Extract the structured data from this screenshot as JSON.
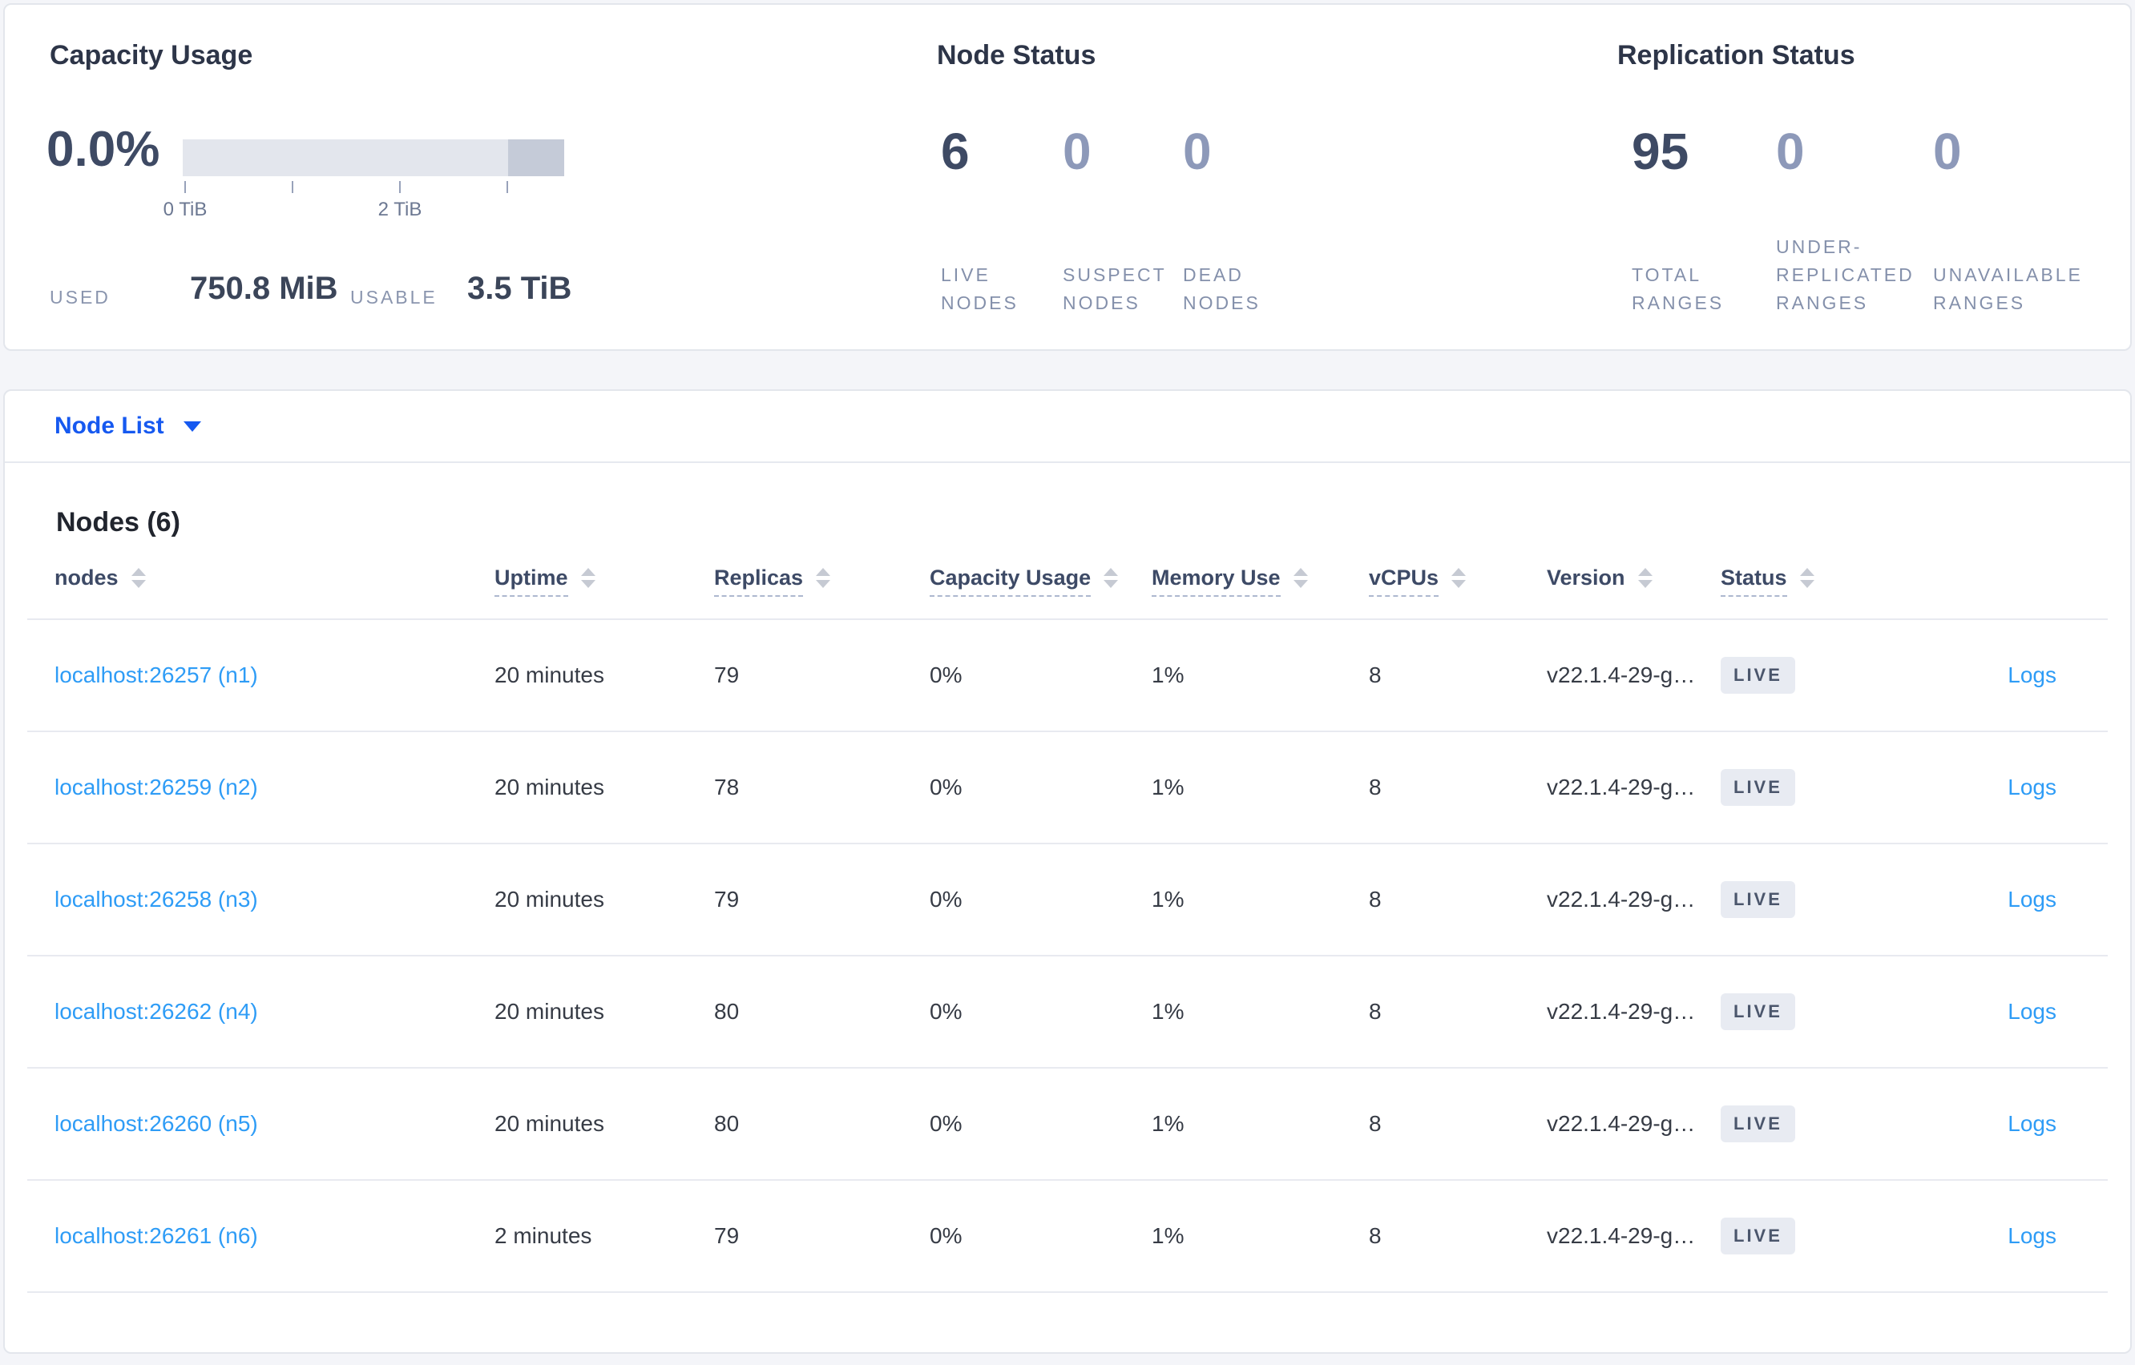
{
  "colors": {
    "accent_blue": "#1659f0",
    "link_blue": "#2e9cf6",
    "dark_number": "#3e4a64",
    "muted_number": "#8d99b9",
    "badge_bg": "#e8ebf2",
    "bar_light": "#e3e6ed",
    "bar_dark": "#c5cbd8"
  },
  "capacity": {
    "title": "Capacity Usage",
    "percent": "0.0%",
    "axis_label_0": "0 TiB",
    "axis_label_2": "2 TiB",
    "used_label": "USED",
    "used_value": "750.8 MiB",
    "usable_label": "USABLE",
    "usable_value": "3.5 TiB"
  },
  "node_status": {
    "title": "Node Status",
    "stats": [
      {
        "value": "6",
        "label": "LIVE\nNODES"
      },
      {
        "value": "0",
        "label": "SUSPECT\nNODES"
      },
      {
        "value": "0",
        "label": "DEAD\nNODES"
      }
    ]
  },
  "replication_status": {
    "title": "Replication Status",
    "stats": [
      {
        "value": "95",
        "label": "TOTAL\nRANGES"
      },
      {
        "value": "0",
        "label": "UNDER-\nREPLICATED\nRANGES"
      },
      {
        "value": "0",
        "label": "UNAVAILABLE\nRANGES"
      }
    ]
  },
  "node_list": {
    "selector_label": "Node List",
    "heading": "Nodes (6)"
  },
  "table": {
    "columns": [
      "nodes",
      "Uptime",
      "Replicas",
      "Capacity Usage",
      "Memory Use",
      "vCPUs",
      "Version",
      "Status"
    ],
    "rows": [
      {
        "node": "localhost:26257 (n1)",
        "uptime": "20 minutes",
        "replicas": "79",
        "capacity": "0%",
        "memory": "1%",
        "vcpus": "8",
        "version": "v22.1.4-29-g…",
        "status": "LIVE",
        "logs": "Logs"
      },
      {
        "node": "localhost:26259 (n2)",
        "uptime": "20 minutes",
        "replicas": "78",
        "capacity": "0%",
        "memory": "1%",
        "vcpus": "8",
        "version": "v22.1.4-29-g…",
        "status": "LIVE",
        "logs": "Logs"
      },
      {
        "node": "localhost:26258 (n3)",
        "uptime": "20 minutes",
        "replicas": "79",
        "capacity": "0%",
        "memory": "1%",
        "vcpus": "8",
        "version": "v22.1.4-29-g…",
        "status": "LIVE",
        "logs": "Logs"
      },
      {
        "node": "localhost:26262 (n4)",
        "uptime": "20 minutes",
        "replicas": "80",
        "capacity": "0%",
        "memory": "1%",
        "vcpus": "8",
        "version": "v22.1.4-29-g…",
        "status": "LIVE",
        "logs": "Logs"
      },
      {
        "node": "localhost:26260 (n5)",
        "uptime": "20 minutes",
        "replicas": "80",
        "capacity": "0%",
        "memory": "1%",
        "vcpus": "8",
        "version": "v22.1.4-29-g…",
        "status": "LIVE",
        "logs": "Logs"
      },
      {
        "node": "localhost:26261 (n6)",
        "uptime": "2 minutes",
        "replicas": "79",
        "capacity": "0%",
        "memory": "1%",
        "vcpus": "8",
        "version": "v22.1.4-29-g…",
        "status": "LIVE",
        "logs": "Logs"
      }
    ]
  }
}
